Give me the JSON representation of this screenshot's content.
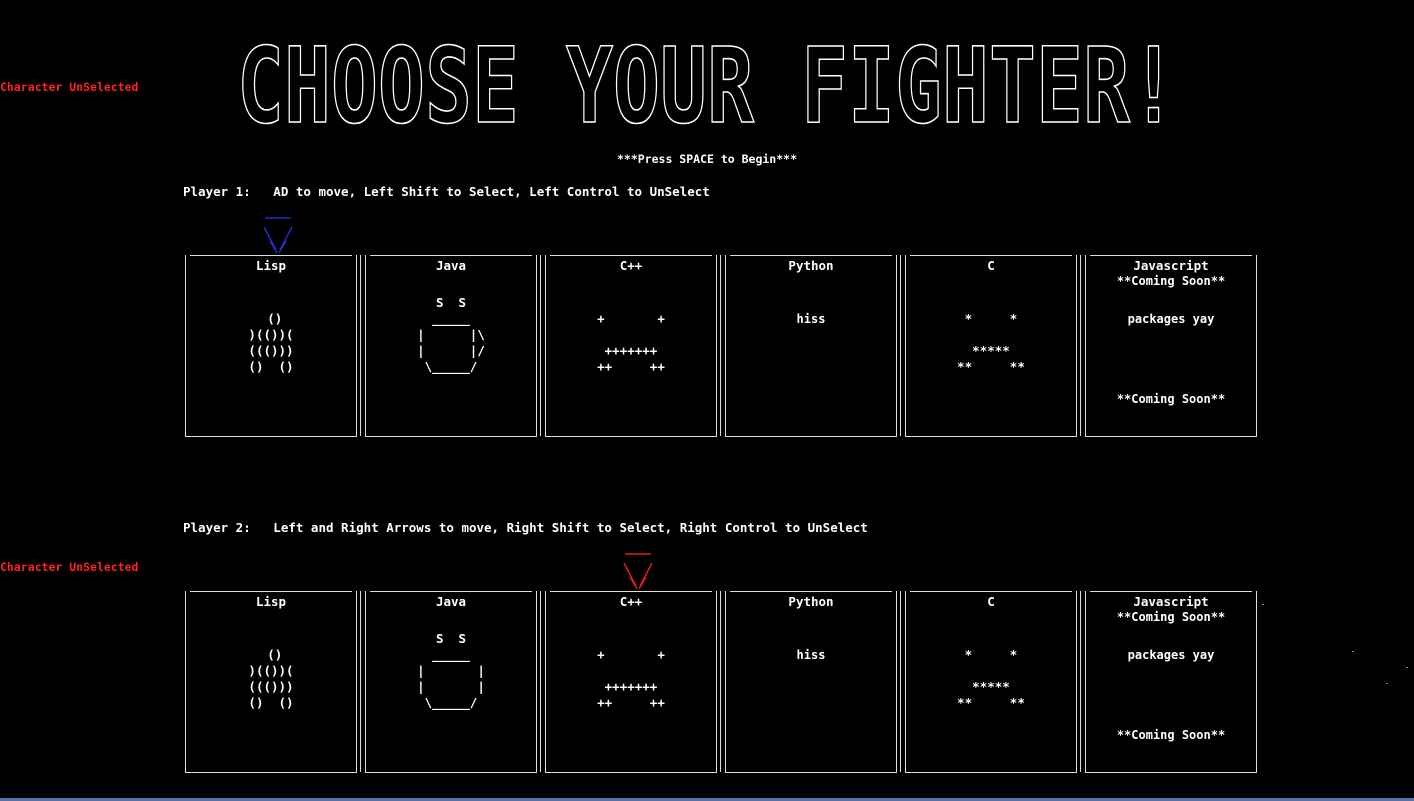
{
  "title": "CHOOSE YOUR FIGHTER!",
  "prompt": "***Press SPACE to Begin***",
  "player1": {
    "status": "Character UnSelected",
    "instructions": "Player 1:   AD to move, Left Shift to Select, Left Control to UnSelect",
    "cursor_color": "#1f2fd0",
    "selected_index": 0
  },
  "player2": {
    "status": "Character UnSelected",
    "instructions": "Player 2:   Left and Right Arrows to move, Right Shift to Select, Right Control to UnSelect",
    "cursor_color": "#e02020",
    "selected_index": 2
  },
  "fighters": [
    {
      "name": "Lisp"
    },
    {
      "name": "Java"
    },
    {
      "name": "C++"
    },
    {
      "name": "Python",
      "text": "hiss"
    },
    {
      "name": "C"
    },
    {
      "name": "Javascript",
      "note_top": "**Coming Soon**",
      "text": "packages yay",
      "note_bottom": "**Coming Soon**"
    }
  ],
  "colors": {
    "background": "#000000",
    "status": "#ff2222",
    "text": "#ffffff",
    "frame": "#dddddd"
  }
}
